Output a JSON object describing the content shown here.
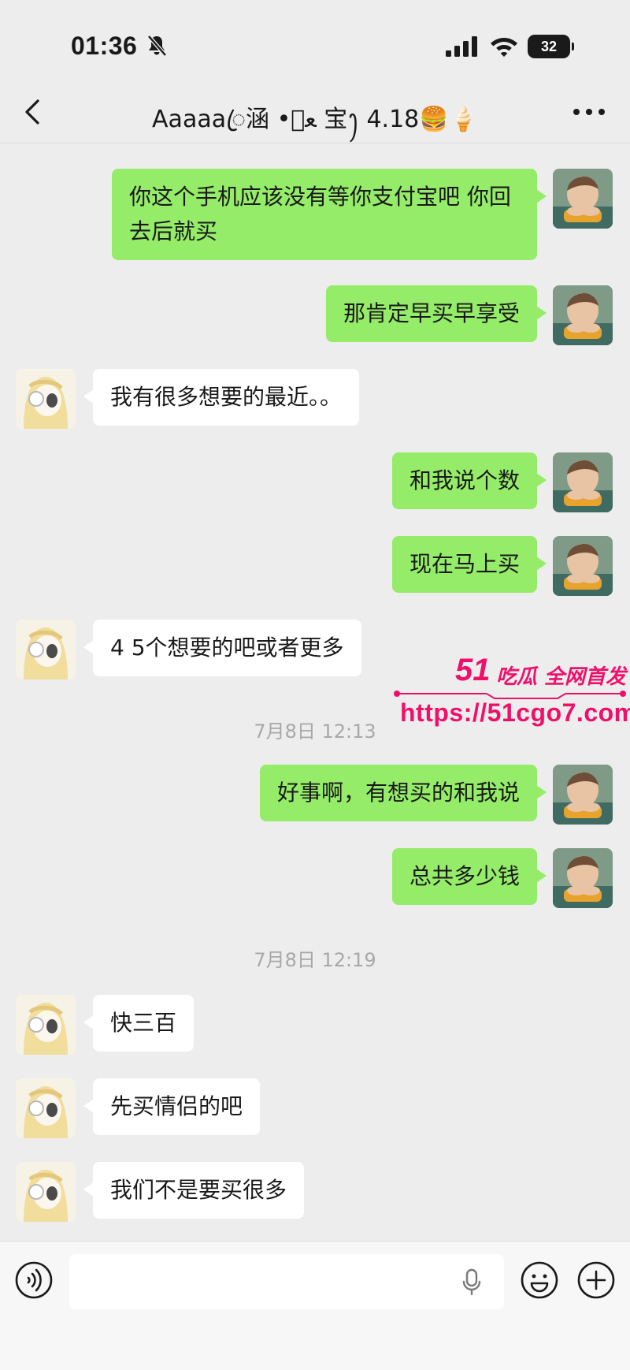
{
  "status_bar": {
    "time": "01:36",
    "battery": "32"
  },
  "nav": {
    "title": "Aaaaaꦿ涵 •ﻌ︤ 宝ꫂ 4.18🍔🍦"
  },
  "messages": [
    {
      "sender": "me",
      "text": "你这个手机应该没有等你支付宝吧 你回去后就买"
    },
    {
      "sender": "me",
      "text": "那肯定早买早享受"
    },
    {
      "sender": "other",
      "text": "我有很多想要的最近。。"
    },
    {
      "sender": "me",
      "text": "和我说个数"
    },
    {
      "sender": "me",
      "text": "现在马上买"
    },
    {
      "sender": "other",
      "text": "4 5个想要的吧或者更多"
    },
    {
      "type": "time",
      "text": "7月8日 12:13"
    },
    {
      "sender": "me",
      "text": "好事啊，有想买的和我说"
    },
    {
      "sender": "me",
      "text": "总共多少钱"
    },
    {
      "type": "time",
      "text": "7月8日 12:19"
    },
    {
      "sender": "other",
      "text": "快三百"
    },
    {
      "sender": "other",
      "text": "先买情侣的吧"
    },
    {
      "sender": "other",
      "text": "我们不是要买很多"
    }
  ],
  "watermark": {
    "brand_number": "51",
    "brand_tag": "吃瓜 全网首发",
    "url": "https://51cgo7.com"
  },
  "colors": {
    "background": "#ededed",
    "my_bubble": "#95ec69",
    "other_bubble": "#ffffff",
    "watermark": "#f0106a"
  },
  "icons": {
    "status": [
      "bell-slash-icon",
      "signal-icon",
      "wifi-icon",
      "battery-icon"
    ],
    "nav": [
      "back-arrow-icon",
      "more-dots-icon"
    ],
    "input": [
      "voice-icon",
      "mic-icon",
      "emoji-icon",
      "plus-icon"
    ]
  }
}
